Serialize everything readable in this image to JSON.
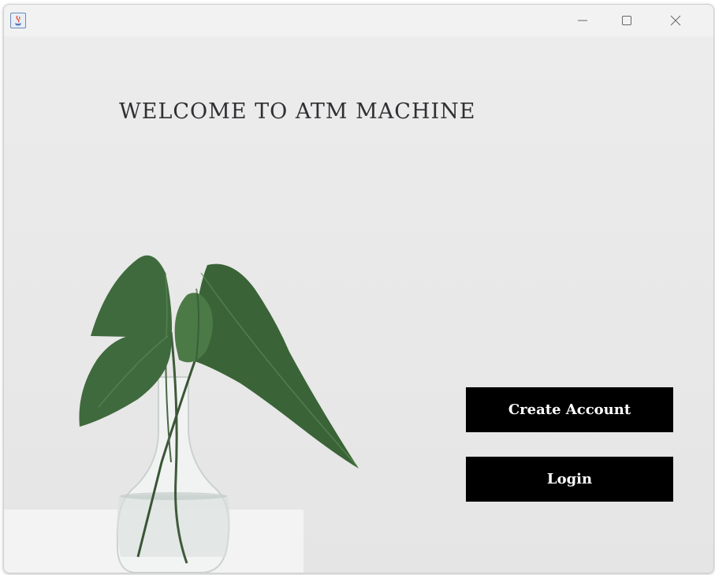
{
  "window": {
    "controls": {
      "minimize_icon": "minimize-icon",
      "maximize_icon": "maximize-icon",
      "close_icon": "close-icon"
    }
  },
  "main": {
    "heading": "WELCOME TO ATM MACHINE",
    "background_image": "plant-in-glass-vase",
    "buttons": {
      "create_account": "Create Account",
      "login": "Login"
    }
  },
  "colors": {
    "background": "#e9e9e9",
    "button_bg": "#000000",
    "button_text": "#ffffff",
    "heading_text": "#2f3033",
    "leaf": "#3e6b3c"
  }
}
